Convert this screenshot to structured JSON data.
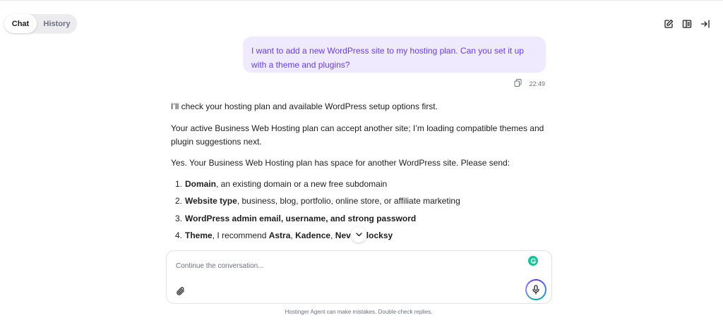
{
  "tabs": [
    {
      "label": "Chat",
      "active": true
    },
    {
      "label": "History",
      "active": false
    }
  ],
  "toolbar": {
    "icons": [
      "edit-icon",
      "sidebar-panel-icon",
      "collapse-panel-icon"
    ]
  },
  "conversation": {
    "user_message": {
      "text": "I want to add a new WordPress site to my hosting plan. Can you set it up with a theme and plugins?",
      "time": "22:49"
    },
    "assistant": {
      "paragraphs": [
        "I’ll check your hosting plan and available WordPress setup options first.",
        "Your active Business Web Hosting plan can accept another site; I’m loading compatible themes and plugin suggestions next.",
        "Yes. Your Business Web Hosting plan has space for another WordPress site. Please send:"
      ],
      "list": [
        {
          "num": "1.",
          "bold": "Domain",
          "rest": ", an existing domain or a new free subdomain"
        },
        {
          "num": "2.",
          "bold": "Website type",
          "rest": ", business, blog, portfolio, online store, or affiliate marketing"
        },
        {
          "num": "3.",
          "bold": "WordPress admin email, username, and strong password",
          "rest": ""
        },
        {
          "num": "4.",
          "bold": "Theme",
          "rest": ", I recommend ",
          "themes": [
            "Astra",
            "Kadence",
            "Neve",
            "Blocksy"
          ]
        }
      ]
    }
  },
  "composer": {
    "placeholder": "Continue the conversation...",
    "value": ""
  },
  "colors": {
    "accent": "#673de6",
    "bubble_bg": "#efeafe",
    "grammarly": "#15c39a"
  },
  "footer": {
    "disclaimer": "Hostinger Agent can make mistakes. Double-check replies."
  }
}
